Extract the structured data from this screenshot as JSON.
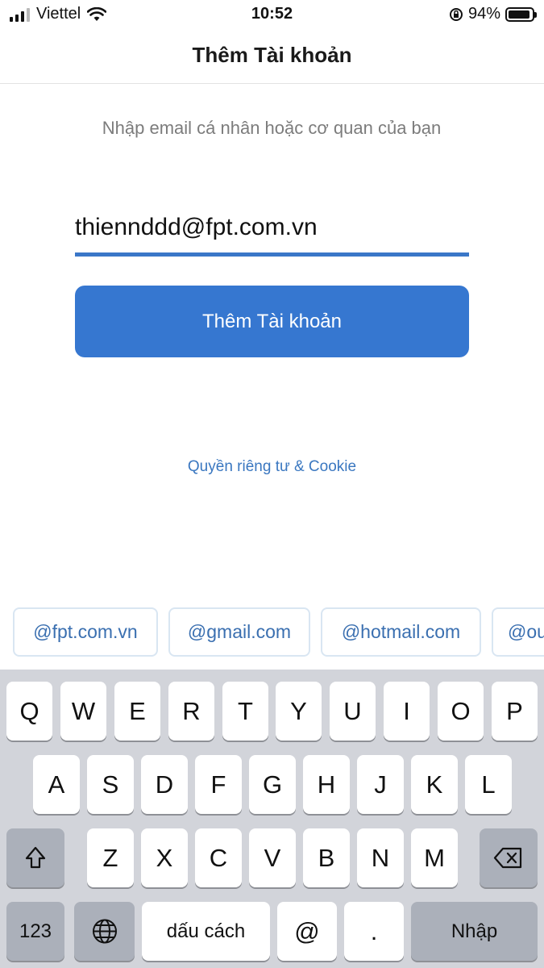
{
  "status_bar": {
    "carrier": "Viettel",
    "time": "10:52",
    "battery": "94%",
    "battery_level": 0.94,
    "icons": [
      "signal-icon",
      "wifi-icon",
      "orientation-lock-icon",
      "battery-icon"
    ]
  },
  "header": {
    "title": "Thêm Tài khoản"
  },
  "form": {
    "instruction": "Nhập email cá nhân hoặc cơ quan của bạn",
    "email_value": "thiennddd@fpt.com.vn",
    "submit_label": "Thêm Tài khoản",
    "accent_color": "#3677d0"
  },
  "privacy_link": "Quyền riêng tư & Cookie",
  "suggestions": [
    "@fpt.com.vn",
    "@gmail.com",
    "@hotmail.com",
    "@ou"
  ],
  "keyboard": {
    "row1": [
      "Q",
      "W",
      "E",
      "R",
      "T",
      "Y",
      "U",
      "I",
      "O",
      "P"
    ],
    "row2": [
      "A",
      "S",
      "D",
      "F",
      "G",
      "H",
      "J",
      "K",
      "L"
    ],
    "row3": [
      "Z",
      "X",
      "C",
      "V",
      "B",
      "N",
      "M"
    ],
    "numbers_label": "123",
    "space_label": "dấu cách",
    "at_label": "@",
    "dot_label": ".",
    "return_label": "Nhập",
    "icons": [
      "shift-icon",
      "backspace-icon",
      "globe-icon"
    ]
  }
}
